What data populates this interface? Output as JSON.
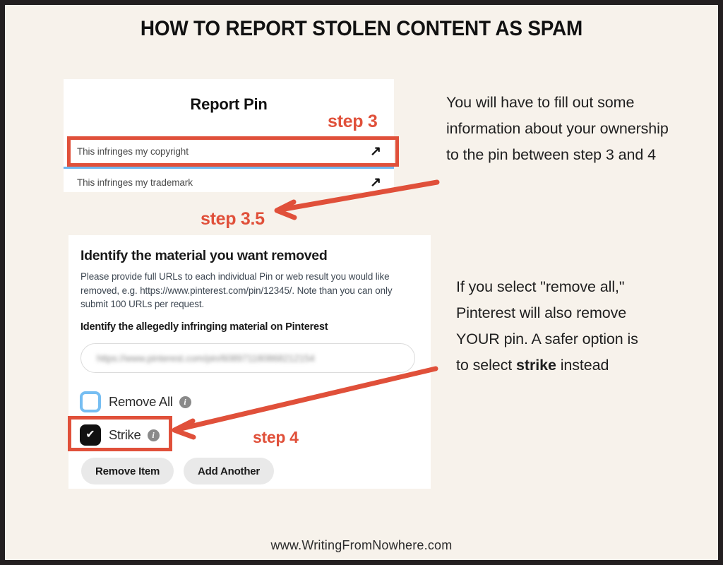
{
  "title": "HOW TO REPORT STOLEN CONTENT AS SPAM",
  "colors": {
    "accent_orange": "#E0503A",
    "background_cream": "#F7F2EB",
    "frame_black": "#231F20",
    "checkbox_blue": "#76BEF2",
    "divider_blue": "#6FB7F0"
  },
  "report_pin_card": {
    "heading": "Report Pin",
    "rows": [
      {
        "label": "This infringes my copyright",
        "icon": "external-link-arrow-icon"
      },
      {
        "label": "This infringes my trademark",
        "icon": "external-link-arrow-icon"
      }
    ]
  },
  "identify_card": {
    "heading": "Identify the material you want removed",
    "body": "Please provide full URLs to each individual Pin or web result you would like removed, e.g. https://www.pinterest.com/pin/12345/. Note than you can only submit 100 URLs per request.",
    "subheading": "Identify the allegedly infringing material on Pinterest",
    "url_input": {
      "value": "https://www.pinterest.com/pin/608971180868212154",
      "placeholder": "https://www.pinterest.com/pin/"
    },
    "checkboxes": [
      {
        "label": "Remove All",
        "checked": false,
        "info": "i"
      },
      {
        "label": "Strike",
        "checked": true,
        "info": "i",
        "check_glyph": "✔"
      }
    ],
    "buttons": [
      {
        "label": "Remove Item"
      },
      {
        "label": "Add Another"
      }
    ]
  },
  "step_labels": {
    "step3": "step 3",
    "step35": "step 3.5",
    "step4": "step 4"
  },
  "annotations": {
    "top": "You will have to fill out some information about your ownership to the pin between step 3 and 4",
    "bottom_part1": "If you select \"remove all,\" Pinterest will also remove YOUR pin. A safer option is to select ",
    "bottom_bold": "strike",
    "bottom_part2": " instead"
  },
  "footer": {
    "url": "www.WritingFromNowhere.com"
  }
}
